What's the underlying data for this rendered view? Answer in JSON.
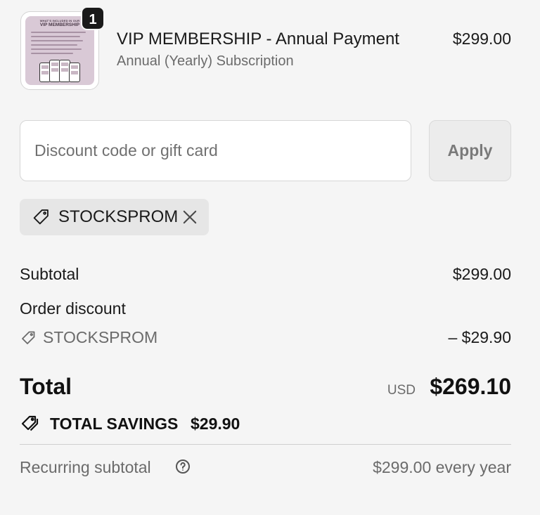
{
  "product": {
    "quantity_badge": "1",
    "name": "VIP MEMBERSHIP - Annual Payment",
    "subtitle": "Annual (Yearly) Subscription",
    "price": "$299.00",
    "thumbnail": {
      "heading_small": "WHAT'S INCLUDED IN OUR",
      "heading_large": "VIP MEMBERSHIP"
    }
  },
  "discount": {
    "input_placeholder": "Discount code or gift card",
    "input_value": "",
    "apply_label": "Apply",
    "applied_code": "STOCKSPROM",
    "tag_icon": "tag-icon",
    "remove_icon": "close-icon"
  },
  "summary": {
    "subtotal_label": "Subtotal",
    "subtotal_value": "$299.00",
    "order_discount_label": "Order discount",
    "discount_code": "STOCKSPROM",
    "discount_value": "– $29.90",
    "total_label": "Total",
    "total_currency": "USD",
    "total_value": "$269.10",
    "savings_label": "TOTAL SAVINGS",
    "savings_value": "$29.90",
    "recurring_label": "Recurring subtotal",
    "recurring_value": "$299.00 every year",
    "help_icon": "question-circle-icon"
  },
  "colors": {
    "background": "#f5f5f5",
    "chip_background": "#e6e6e6",
    "text_primary": "#1a1a1a",
    "text_muted": "#6b6b6b"
  }
}
